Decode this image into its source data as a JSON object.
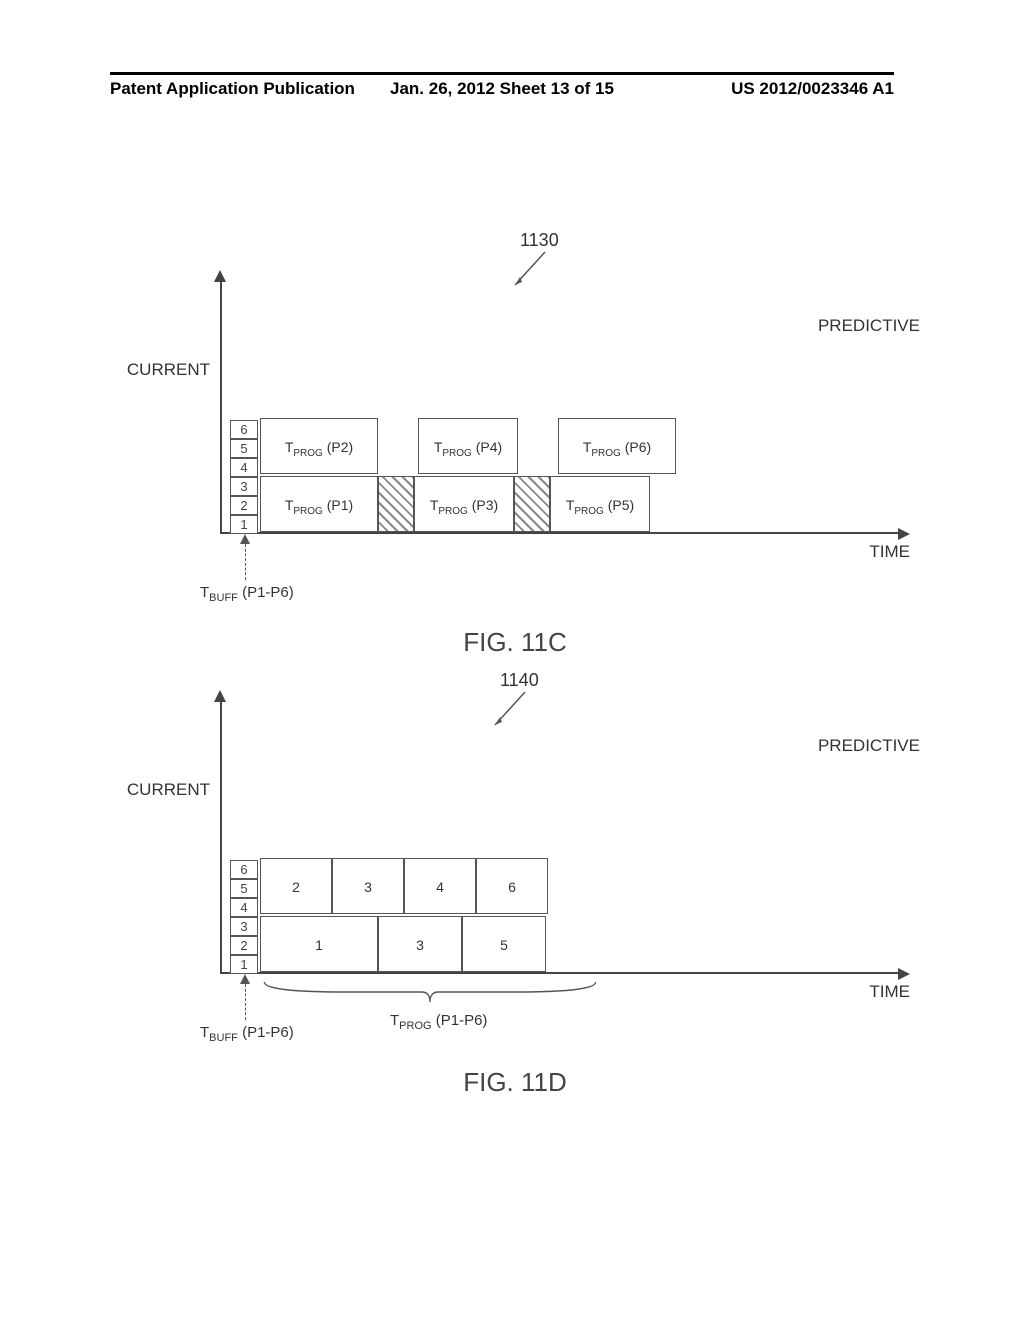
{
  "header": {
    "left": "Patent Application Publication",
    "mid": "Jan. 26, 2012  Sheet 13 of 15",
    "right": "US 2012/0023346 A1"
  },
  "axis": {
    "y": "CURRENT",
    "x": "TIME",
    "side": "PREDICTIVE"
  },
  "buff": {
    "cells": [
      "6",
      "5",
      "4",
      "3",
      "2",
      "1"
    ],
    "label_html": "T<sub>BUFF</sub> (P1-P6)"
  },
  "fig11c": {
    "ref": "1130",
    "caption": "FIG. 11C",
    "row_top": [
      {
        "t": "tprog",
        "label_html": "T<sub>PROG</sub> (P2)",
        "cls": "w0"
      },
      {
        "t": "gap",
        "cls": "gap2"
      },
      {
        "t": "tprog",
        "label_html": "T<sub>PROG</sub> (P4)",
        "cls": "w1"
      },
      {
        "t": "gap",
        "cls": "gap2"
      },
      {
        "t": "tprog",
        "label_html": "T<sub>PROG</sub> (P6)",
        "cls": "w0"
      }
    ],
    "row_bot": [
      {
        "t": "tprog",
        "label_html": "T<sub>PROG</sub> (P1)",
        "cls": "w0"
      },
      {
        "t": "hatch",
        "cls": "gap"
      },
      {
        "t": "tprog",
        "label_html": "T<sub>PROG</sub> (P3)",
        "cls": "w1"
      },
      {
        "t": "hatch",
        "cls": "gap"
      },
      {
        "t": "tprog",
        "label_html": "T<sub>PROG</sub> (P5)",
        "cls": "w1"
      }
    ]
  },
  "fig11d": {
    "ref": "1140",
    "caption": "FIG. 11D",
    "row_top": [
      {
        "t": "plain",
        "label": "2",
        "cls": "w3"
      },
      {
        "t": "plain",
        "label": "3",
        "cls": "w3"
      },
      {
        "t": "plain",
        "label": "4",
        "cls": "w3"
      },
      {
        "t": "plain",
        "label": "6",
        "cls": "w3"
      }
    ],
    "row_bot": [
      {
        "t": "plain",
        "label": "1",
        "cls": "w0"
      },
      {
        "t": "plain",
        "label": "3",
        "cls": "w2"
      },
      {
        "t": "plain",
        "label": "5",
        "cls": "w2"
      }
    ],
    "tprog_under_html": "T<sub>PROG</sub> (P1-P6)"
  },
  "chart_data": [
    {
      "type": "bar",
      "id": "fig-11c",
      "ref": "1130",
      "title": "FIG. 11C",
      "xlabel": "TIME",
      "ylabel": "CURRENT",
      "annotation": "PREDICTIVE",
      "buffer_stack": [
        1,
        2,
        3,
        4,
        5,
        6
      ],
      "buffer_label": "TBUFF (P1-P6)",
      "lanes": {
        "top": [
          "TPROG (P2)",
          null,
          "TPROG (P4)",
          null,
          "TPROG (P6)"
        ],
        "bottom": [
          "TPROG (P1)",
          "idle-hatched",
          "TPROG (P3)",
          "idle-hatched",
          "TPROG (P5)"
        ]
      }
    },
    {
      "type": "bar",
      "id": "fig-11d",
      "ref": "1140",
      "title": "FIG. 11D",
      "xlabel": "TIME",
      "ylabel": "CURRENT",
      "annotation": "PREDICTIVE",
      "buffer_stack": [
        1,
        2,
        3,
        4,
        5,
        6
      ],
      "buffer_label": "TBUFF (P1-P6)",
      "tprog_span_label": "TPROG (P1-P6)",
      "lanes": {
        "top": [
          2,
          3,
          4,
          6
        ],
        "bottom": [
          1,
          3,
          5
        ]
      }
    }
  ]
}
